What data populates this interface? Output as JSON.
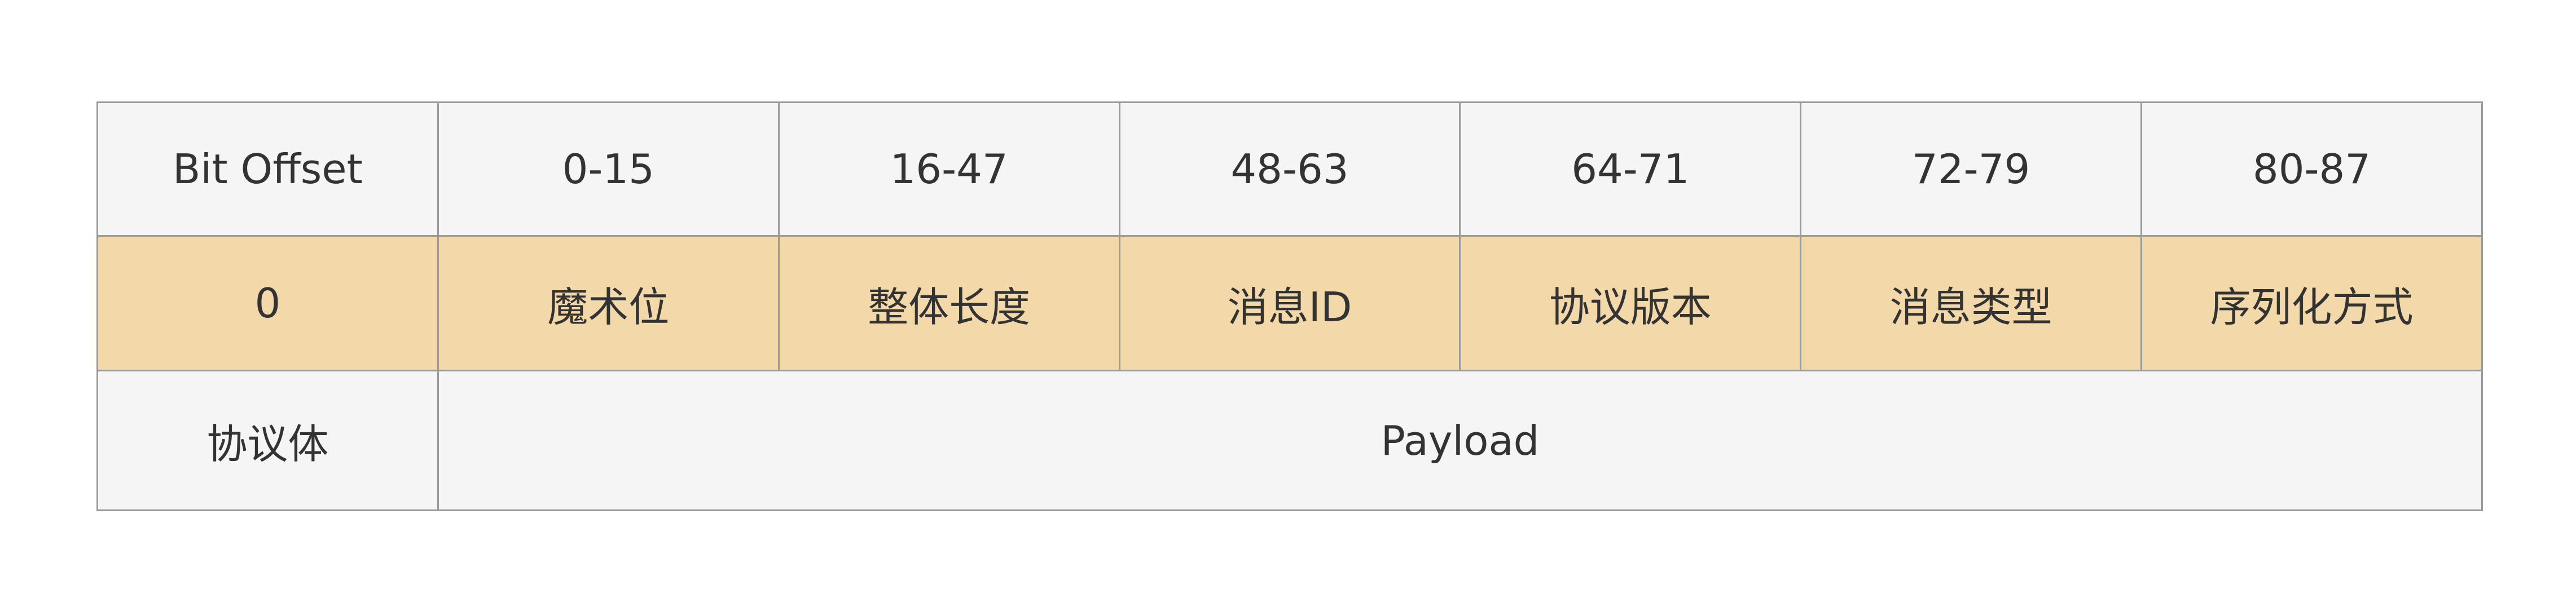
{
  "header_row": {
    "label": "Bit Offset",
    "ranges": [
      "0-15",
      "16-47",
      "48-63",
      "64-71",
      "72-79",
      "80-87"
    ]
  },
  "fields_row": {
    "label": "0",
    "fields": [
      "魔术位",
      "整体长度",
      "消息ID",
      "协议版本",
      "消息类型",
      "序列化方式"
    ]
  },
  "body_row": {
    "label": "协议体",
    "payload": "Payload"
  },
  "colors": {
    "header_bg": "#f5f5f5",
    "field_bg": "#f3d9a9",
    "border": "#9a9a9a",
    "text": "#333333"
  }
}
